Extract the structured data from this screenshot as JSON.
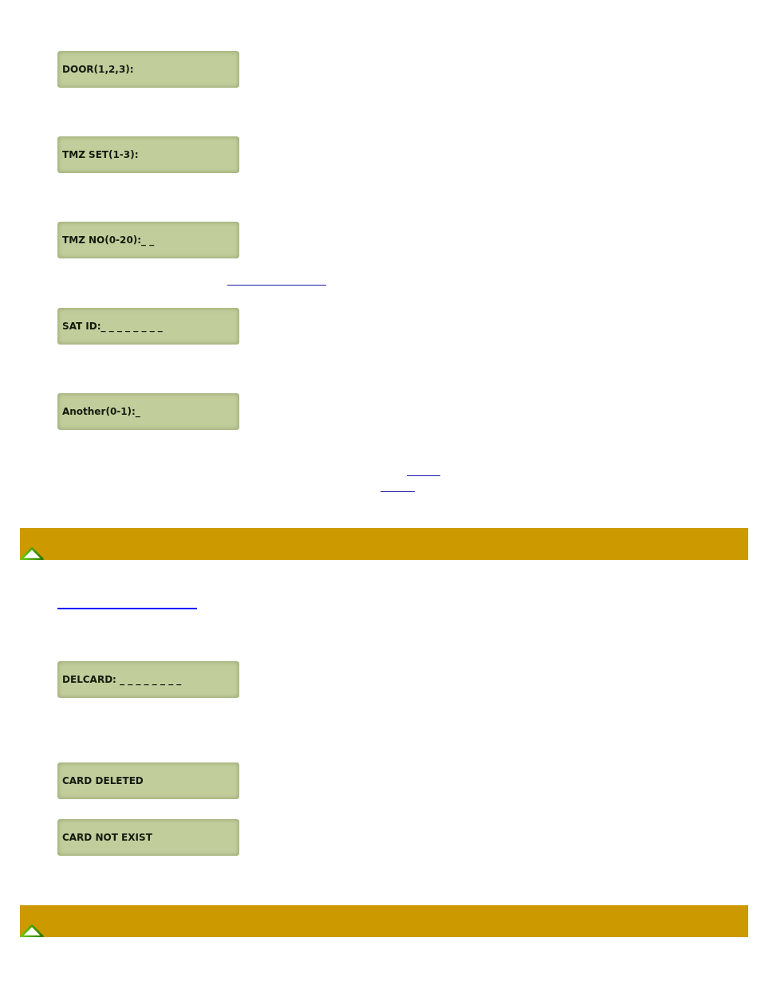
{
  "blocks": [
    {
      "kind": "lcd",
      "text": "DOOR(1,2,3):"
    },
    {
      "kind": "lcd",
      "text": "TMZ SET(1-3):"
    },
    {
      "kind": "lcd",
      "text": "TMZ NO(0-20):_ _"
    },
    {
      "kind": "link_line"
    },
    {
      "kind": "lcd",
      "text": "SAT ID:_ _ _ _ _ _ _ _"
    },
    {
      "kind": "lcd",
      "text": "Another(0-1):_"
    },
    {
      "kind": "link_line"
    },
    {
      "kind": "link_line"
    },
    {
      "kind": "bar"
    },
    {
      "kind": "link_line"
    },
    {
      "kind": "lcd",
      "text": "DELCARD: _ _ _ _ _ _ _ _"
    },
    {
      "kind": "lcd",
      "text": "CARD DELETED"
    },
    {
      "kind": "lcd",
      "text": "CARD NOT EXIST"
    },
    {
      "kind": "bar"
    }
  ]
}
